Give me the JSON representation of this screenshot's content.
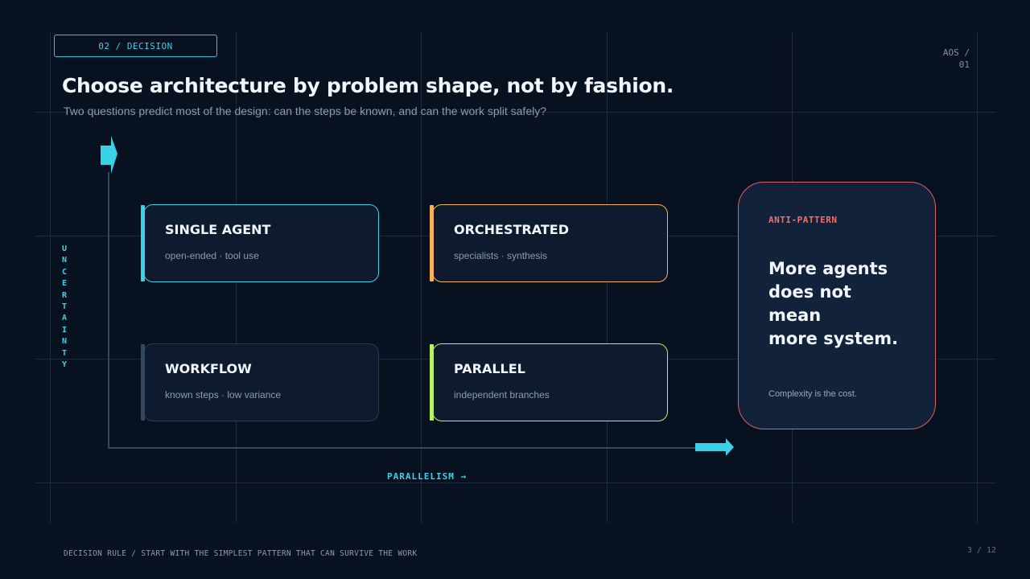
{
  "header": {
    "section_tag": "02 / DECISION",
    "corner_tag": "AOS / 01",
    "title": "Choose architecture by problem shape, not by fashion.",
    "subtitle": "Two questions predict most of the design: can the steps be known, and can the work split safely?"
  },
  "axes": {
    "y_label": "UNCERTAINTY",
    "x_label": "PARALLELISM →"
  },
  "quadrants": [
    {
      "title": "SINGLE AGENT",
      "subtitle": "open-ended · tool use",
      "accent": "#39d2e6"
    },
    {
      "title": "ORCHESTRATED",
      "subtitle": "specialists · synthesis",
      "accent": "#f5b25a"
    },
    {
      "title": "WORKFLOW",
      "subtitle": "known steps · low variance",
      "accent": "#33475f"
    },
    {
      "title": "PARALLEL",
      "subtitle": "independent branches",
      "accent": "#b8f06a"
    }
  ],
  "anti_pattern": {
    "label": "ANTI-PATTERN",
    "headline_lines": [
      "More agents",
      "does not",
      "mean",
      "more system."
    ],
    "note": "Complexity is the cost.",
    "accent": "#e0605f"
  },
  "footer": {
    "rule": "DECISION RULE / START WITH THE SIMPLEST PATTERN THAT CAN SURVIVE THE WORK",
    "page_number": "3 / 12"
  },
  "colors": {
    "background": "#08111f",
    "primary_accent": "#39d2e6"
  }
}
